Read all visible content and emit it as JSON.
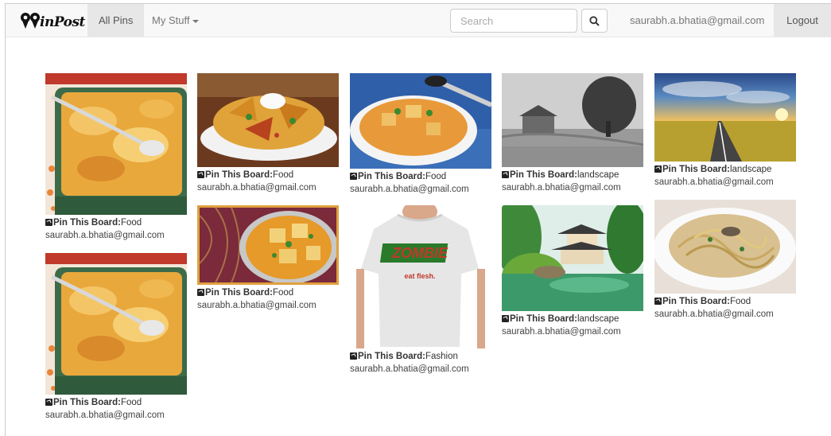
{
  "navbar": {
    "logo_text": "inPost",
    "all_pins": "All Pins",
    "my_stuff": "My Stuff",
    "search_placeholder": "Search",
    "user_email": "saurabh.a.bhatia@gmail.com",
    "logout": "Logout"
  },
  "pin_label": "Pin This Board:",
  "pins": [
    {
      "board": "Food",
      "email": "saurabh.a.bhatia@gmail.com",
      "image": "casserole"
    },
    {
      "board": "Food",
      "email": "saurabh.a.bhatia@gmail.com",
      "image": "casserole"
    },
    {
      "board": "Food",
      "email": "saurabh.a.bhatia@gmail.com",
      "image": "nachos"
    },
    {
      "board": "Food",
      "email": "saurabh.a.bhatia@gmail.com",
      "image": "paneer-curry"
    },
    {
      "board": "Food",
      "email": "saurabh.a.bhatia@gmail.com",
      "image": "curry-bowl"
    },
    {
      "board": "Fashion",
      "email": "saurabh.a.bhatia@gmail.com",
      "image": "zombie-tshirt"
    },
    {
      "board": "landscape",
      "email": "saurabh.a.bhatia@gmail.com",
      "image": "old-house"
    },
    {
      "board": "landscape",
      "email": "saurabh.a.bhatia@gmail.com",
      "image": "japanese-pavilion"
    },
    {
      "board": "landscape",
      "email": "saurabh.a.bhatia@gmail.com",
      "image": "sunset-road"
    },
    {
      "board": "Food",
      "email": "saurabh.a.bhatia@gmail.com",
      "image": "pasta"
    }
  ],
  "tshirt": {
    "brand": "ZOMBIE",
    "tagline": "eat flesh."
  }
}
